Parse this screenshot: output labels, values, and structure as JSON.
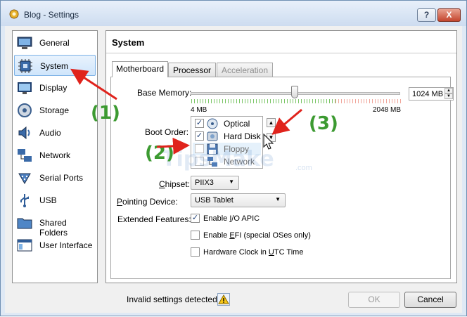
{
  "window": {
    "title": "Blog - Settings",
    "help_label": "?",
    "close_label": "X"
  },
  "sidebar": {
    "items": [
      {
        "label": "General",
        "icon": "monitor-icon"
      },
      {
        "label": "System",
        "icon": "chip-icon"
      },
      {
        "label": "Display",
        "icon": "display-icon"
      },
      {
        "label": "Storage",
        "icon": "storage-icon"
      },
      {
        "label": "Audio",
        "icon": "speaker-icon"
      },
      {
        "label": "Network",
        "icon": "network-icon"
      },
      {
        "label": "Serial Ports",
        "icon": "serial-port-icon"
      },
      {
        "label": "USB",
        "icon": "usb-icon"
      },
      {
        "label": "Shared Folders",
        "icon": "folder-icon"
      },
      {
        "label": "User Interface",
        "icon": "window-icon"
      }
    ],
    "selected": "System"
  },
  "panel": {
    "title": "System"
  },
  "tabs": [
    {
      "label": "Motherboard",
      "state": "active"
    },
    {
      "label": "Processor",
      "state": "normal"
    },
    {
      "label": "Acceleration",
      "state": "disabled"
    }
  ],
  "motherboard": {
    "base_memory_label": "Base Memory:",
    "memory_min": "4 MB",
    "memory_max": "2048 MB",
    "memory_value": "1024 MB",
    "boot_order_label": "Boot Order:",
    "boot_items": [
      {
        "label": "Optical",
        "checked": true
      },
      {
        "label": "Hard Disk",
        "checked": true
      },
      {
        "label": "Floppy",
        "checked": false
      },
      {
        "label": "Network",
        "checked": false
      }
    ],
    "chipset_label": "Chipset:",
    "chipset_value": "PIIX3",
    "pointing_label": "Pointing Device:",
    "pointing_value": "USB Tablet",
    "extended_label": "Extended Features:",
    "features": [
      {
        "label": "Enable I/O APIC",
        "checked": true
      },
      {
        "label": "Enable EFI (special OSes only)",
        "checked": false
      },
      {
        "label": "Hardware Clock in UTC Time",
        "checked": false
      }
    ]
  },
  "status": {
    "text": "Invalid settings detected"
  },
  "buttons": {
    "ok": "OK",
    "cancel": "Cancel"
  },
  "annotations": {
    "one": "(1)",
    "two": "(2)",
    "three": "(3)"
  },
  "watermark": {
    "text": "TipsMake",
    "suffix": ".com"
  },
  "colors": {
    "annotation_green": "#3c9a31",
    "arrow_red": "#e0231c",
    "selection": "#cfe5fb"
  }
}
